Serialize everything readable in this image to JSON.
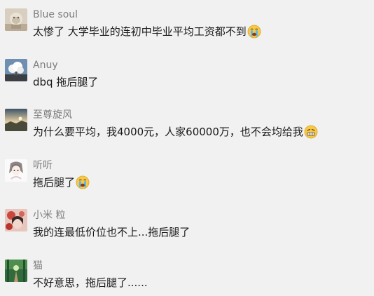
{
  "comments": [
    {
      "name": "Blue soul",
      "text": "太惨了 大学毕业的连初中毕业平均工资都不到",
      "avatar_icon": "stone-lion-avatar",
      "emoji": "crying-face-icon"
    },
    {
      "name": "Anuy",
      "text": "dbq 拖后腿了",
      "avatar_icon": "cotton-tree-avatar",
      "emoji": ""
    },
    {
      "name": "至尊旋风",
      "text": "为什么要平均，我4000元，人家60000万，也不会均给我",
      "avatar_icon": "sky-landscape-avatar",
      "emoji": "grimacing-face-icon"
    },
    {
      "name": "听听",
      "text": "拖后腿了",
      "avatar_icon": "anime-girl-avatar",
      "emoji": "crying-face-icon"
    },
    {
      "name": "小米 粒",
      "text": "我的连最低价位也不上...拖后腿了",
      "avatar_icon": "flower-portrait-avatar",
      "emoji": ""
    },
    {
      "name": "猫",
      "text": "不好意思，拖后腿了......",
      "avatar_icon": "forest-path-avatar",
      "emoji": ""
    }
  ]
}
